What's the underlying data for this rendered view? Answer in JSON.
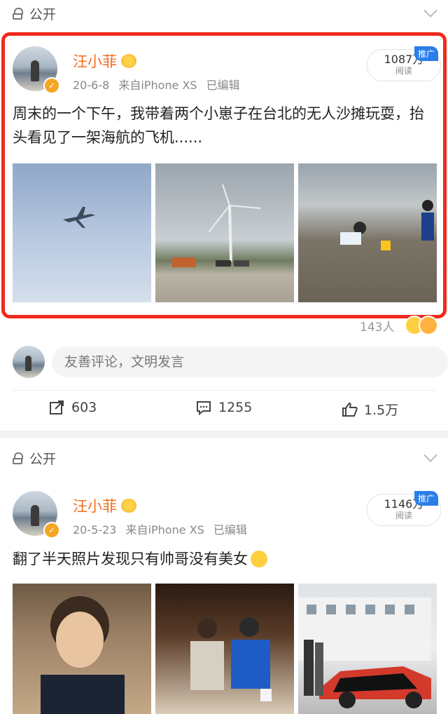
{
  "post1": {
    "visibility": "公开",
    "username": "汪小菲",
    "date": "20-6-8",
    "source": "来自iPhone XS",
    "edited": "已编辑",
    "reads_count": "1087万",
    "reads_label": "阅读",
    "promo_badge": "推广",
    "text": "周末的一个下午，我带着两个小崽子在台北的无人沙摊玩耍，抬头看见了一架海航的飞机......",
    "likes_count": "143人",
    "comment_placeholder": "友善评论，文明发言",
    "share_count": "603",
    "comment_count": "1255",
    "like_count": "1.5万"
  },
  "post2": {
    "visibility": "公开",
    "username": "汪小菲",
    "date": "20-5-23",
    "source": "来自iPhone XS",
    "edited": "已编辑",
    "reads_count": "1146万",
    "reads_label": "阅读",
    "promo_badge": "推广",
    "text": "翻了半天照片发现只有帅哥没有美女"
  },
  "colors": {
    "highlight_border": "#f0291c",
    "username": "#f26b1d",
    "verified": "#f5a623",
    "promo": "#2b7de9"
  },
  "icons": [
    "lock-icon",
    "chevron-down-icon",
    "share-icon",
    "comment-icon",
    "like-icon",
    "laugh-emoji-icon",
    "crown-icon",
    "verified-icon"
  ]
}
